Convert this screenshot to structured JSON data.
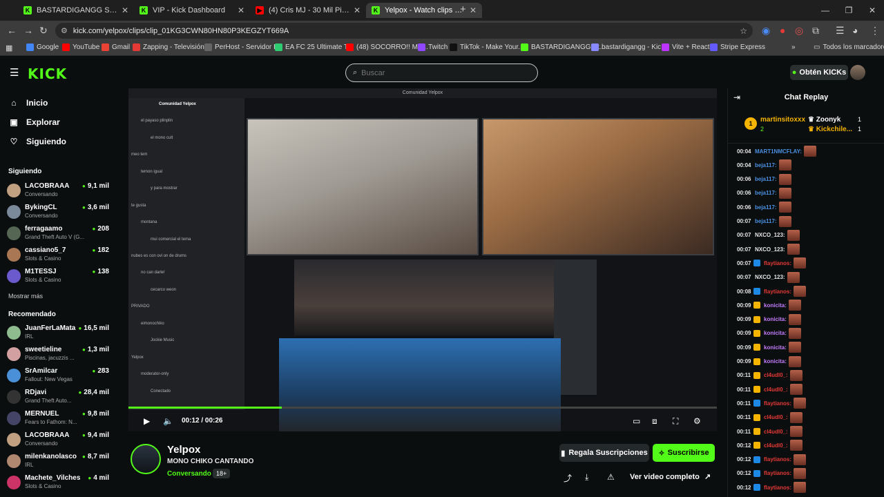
{
  "browser": {
    "tabs": [
      {
        "title": "BASTARDIGANGG Stream - Wa",
        "fav": "K",
        "color": "#53fc18"
      },
      {
        "title": "VIP - Kick Dashboard",
        "fav": "K",
        "color": "#53fc18"
      },
      {
        "title": "(4) Cris MJ - 30 Mil Pies (Video",
        "fav": "▶",
        "color": "#ff0000"
      },
      {
        "title": "Yelpox - Watch clips on Kick",
        "fav": "K",
        "color": "#53fc18"
      }
    ],
    "url": "kick.com/yelpox/clips/clip_01KG3CWN80HN80P3KEGZYT669A",
    "bookmarks": [
      {
        "label": "Google",
        "color": "#4285f4"
      },
      {
        "label": "YouTube",
        "color": "#ff0000"
      },
      {
        "label": "Gmail",
        "color": "#ea4335"
      },
      {
        "label": "Zapping - Televisión...",
        "color": "#e53935"
      },
      {
        "label": "PerHost - Servidor I...",
        "color": "#666"
      },
      {
        "label": "EA FC 25 Ultimate T...",
        "color": "#2ecc71"
      },
      {
        "label": "(48) SOCORRO!! ME...",
        "color": "#ff0000"
      },
      {
        "label": "Twitch",
        "color": "#9146ff"
      },
      {
        "label": "TikTok - Make Your...",
        "color": "#111"
      },
      {
        "label": "BASTARDIGANGG St...",
        "color": "#53fc18"
      },
      {
        "label": "bastardigangg - Kic...",
        "color": "#8888ff"
      },
      {
        "label": "Vite + React",
        "color": "#bd34fe"
      },
      {
        "label": "Stripe Express",
        "color": "#635bff"
      }
    ],
    "all_bookmarks": "Todos los marcadores"
  },
  "header": {
    "logo": "KICK",
    "search_placeholder": "Buscar",
    "kicks_btn": "Obtén KICKs"
  },
  "sidebar": {
    "nav": [
      {
        "label": "Inicio",
        "icon": "home-icon"
      },
      {
        "label": "Explorar",
        "icon": "explore-icon"
      },
      {
        "label": "Siguiendo",
        "icon": "heart-icon"
      }
    ],
    "following_title": "Siguiendo",
    "following": [
      {
        "name": "LACOBRAAA",
        "game": "Conversando",
        "viewers": "9,1 mil",
        "color": "#c0a080"
      },
      {
        "name": "BykingCL",
        "game": "Conversando",
        "viewers": "3,6 mil",
        "color": "#7a8a9a"
      },
      {
        "name": "ferragaamo",
        "game": "Grand Theft Auto V (G...",
        "viewers": "208",
        "color": "#556655"
      },
      {
        "name": "cassiano5_7",
        "game": "Slots & Casino",
        "viewers": "182",
        "color": "#aa7755"
      },
      {
        "name": "M1TESSJ",
        "game": "Slots & Casino",
        "viewers": "138",
        "color": "#6a5acd"
      }
    ],
    "show_more": "Mostrar más",
    "recommended_title": "Recomendado",
    "recommended": [
      {
        "name": "JuanFerLaMata",
        "game": "IRL",
        "viewers": "16,5 mil",
        "color": "#8fbc8f"
      },
      {
        "name": "sweetieline",
        "game": "Piscinas, jacuzzis ...",
        "viewers": "1,3 mil",
        "color": "#d2a0a0"
      },
      {
        "name": "SrAmilcar",
        "game": "Fallout: New Vegas",
        "viewers": "283",
        "color": "#4a90d9"
      },
      {
        "name": "RDjavi",
        "game": "Grand Theft Auto...",
        "viewers": "28,4 mil",
        "color": "#333"
      },
      {
        "name": "MERNUEL",
        "game": "Fears to Fathom: N...",
        "viewers": "9,8 mil",
        "color": "#444466"
      },
      {
        "name": "LACOBRAAA",
        "game": "Conversando",
        "viewers": "9,4 mil",
        "color": "#c0a080"
      },
      {
        "name": "milenkanolasco",
        "game": "IRL",
        "viewers": "8,7 mil",
        "color": "#b08870"
      },
      {
        "name": "Machete_Vilches",
        "game": "Slots & Casino",
        "viewers": "4 mil",
        "color": "#cc3366"
      }
    ]
  },
  "video": {
    "window_title": "Comunidad Yelpox",
    "time": "00:12 / 00:26",
    "progress": 0.26,
    "discord_lines": [
      "Comunidad Yelpox",
      "el payaso plinplin",
      "el mono cult",
      "meo tem",
      "temon igual",
      "y para mostrar",
      "te gusta",
      "montana",
      "mui comercial el tema",
      "nubes es con ovi on de drums",
      "no can darle!",
      "cecarco weon",
      "PRIVADO",
      "eimonochiko",
      "Jockie Music",
      "Yelpox",
      "moderator-only",
      "Conectado"
    ]
  },
  "stream": {
    "name": "Yelpox",
    "clip_title": "MONO CHIKO CANTANDO",
    "category": "Conversando",
    "age": "18+",
    "gift_btn": "Regala Suscripciones",
    "sub_btn": "Suscribirse",
    "full_video": "Ver video completo"
  },
  "chat": {
    "title": "Chat Replay",
    "top": [
      {
        "rank": "1",
        "name": "martinsitoxxx",
        "count": "2"
      },
      {
        "name": "Zoonyk",
        "count": "1"
      },
      {
        "name": "Kickchile...",
        "count": "1"
      }
    ],
    "messages": [
      {
        "t": "00:04",
        "user": "MART1NMCFLAY:",
        "color": "#4a90e2",
        "badge": ""
      },
      {
        "t": "00:04",
        "user": "beja117:",
        "color": "#4a90e2",
        "badge": ""
      },
      {
        "t": "00:06",
        "user": "beja117:",
        "color": "#4a90e2",
        "badge": ""
      },
      {
        "t": "00:06",
        "user": "beja117:",
        "color": "#4a90e2",
        "badge": ""
      },
      {
        "t": "00:06",
        "user": "beja117:",
        "color": "#4a90e2",
        "badge": ""
      },
      {
        "t": "00:07",
        "user": "beja117:",
        "color": "#4a90e2",
        "badge": ""
      },
      {
        "t": "00:07",
        "user": "NXCO_123:",
        "color": "#e6e6e6",
        "badge": ""
      },
      {
        "t": "00:07",
        "user": "NXCO_123:",
        "color": "#e6e6e6",
        "badge": ""
      },
      {
        "t": "00:07",
        "user": "flaytianos:",
        "color": "#e53935",
        "badge": "#1e88e5"
      },
      {
        "t": "00:07",
        "user": "NXCO_123:",
        "color": "#e6e6e6",
        "badge": ""
      },
      {
        "t": "00:08",
        "user": "flaytianos:",
        "color": "#e53935",
        "badge": "#1e88e5"
      },
      {
        "t": "00:09",
        "user": "konicita:",
        "color": "#c77dff",
        "badge": "#f5b400"
      },
      {
        "t": "00:09",
        "user": "konicita:",
        "color": "#c77dff",
        "badge": "#f5b400"
      },
      {
        "t": "00:09",
        "user": "konicita:",
        "color": "#c77dff",
        "badge": "#f5b400"
      },
      {
        "t": "00:09",
        "user": "konicita:",
        "color": "#c77dff",
        "badge": "#f5b400"
      },
      {
        "t": "00:09",
        "user": "konicita:",
        "color": "#c77dff",
        "badge": "#f5b400"
      },
      {
        "t": "00:11",
        "user": "cl4udl0_:",
        "color": "#e53935",
        "badge": "#f5b400"
      },
      {
        "t": "00:11",
        "user": "cl4udl0_:",
        "color": "#e53935",
        "badge": "#f5b400"
      },
      {
        "t": "00:11",
        "user": "flaytianos:",
        "color": "#e53935",
        "badge": "#1e88e5"
      },
      {
        "t": "00:11",
        "user": "cl4udl0_:",
        "color": "#e53935",
        "badge": "#f5b400"
      },
      {
        "t": "00:11",
        "user": "cl4udl0_:",
        "color": "#e53935",
        "badge": "#f5b400"
      },
      {
        "t": "00:12",
        "user": "cl4udl0_:",
        "color": "#e53935",
        "badge": "#f5b400"
      },
      {
        "t": "00:12",
        "user": "flaytianos:",
        "color": "#e53935",
        "badge": "#1e88e5"
      },
      {
        "t": "00:12",
        "user": "flaytianos:",
        "color": "#e53935",
        "badge": "#1e88e5"
      },
      {
        "t": "00:12",
        "user": "flaytianos:",
        "color": "#e53935",
        "badge": "#1e88e5"
      }
    ]
  },
  "colors": {
    "accent": "#53fc18",
    "bg": "#0b0e0f"
  }
}
